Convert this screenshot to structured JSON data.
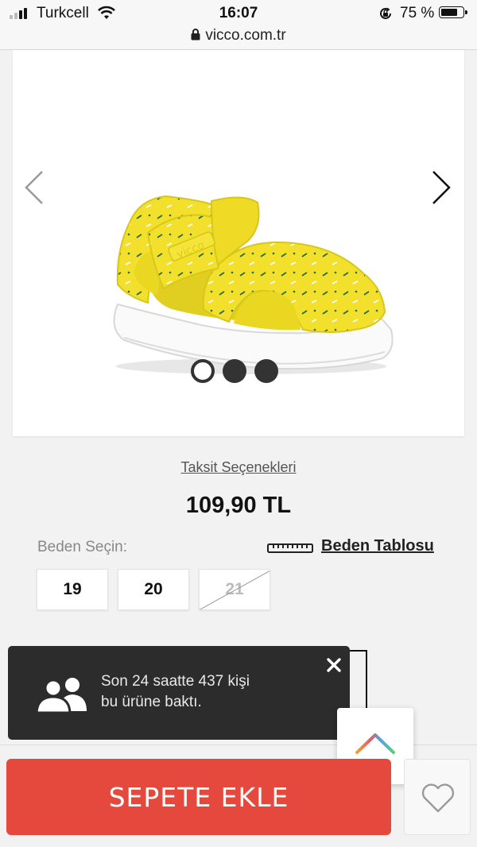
{
  "status_bar": {
    "carrier": "Turkcell",
    "time": "16:07",
    "battery_percent": "75 %",
    "battery_level": 0.75
  },
  "browser": {
    "url": "vicco.com.tr"
  },
  "product": {
    "image_count": 3,
    "active_image": 1,
    "installment_link": "Taksit Seçenekleri",
    "price": "109,90 TL"
  },
  "size_selector": {
    "label": "Beden Seçin:",
    "chart_link": "Beden Tablosu",
    "sizes": [
      {
        "label": "19",
        "available": true
      },
      {
        "label": "20",
        "available": true
      },
      {
        "label": "21",
        "available": false
      }
    ]
  },
  "toast": {
    "line1": "Son 24 saatte 437 kişi",
    "line2": "bu ürüne baktı."
  },
  "actions": {
    "add_to_cart": "SEPETE EKLE"
  },
  "colors": {
    "accent": "#e5483c",
    "toast_bg": "#2c2c2c",
    "product_yellow": "#f3e02c"
  },
  "icons": [
    "signal-icon",
    "wifi-icon",
    "orientation-lock-icon",
    "battery-icon",
    "lock-icon",
    "chevron-left-icon",
    "chevron-right-icon",
    "ruler-icon",
    "people-icon",
    "close-icon",
    "scroll-top-icon",
    "heart-icon"
  ]
}
